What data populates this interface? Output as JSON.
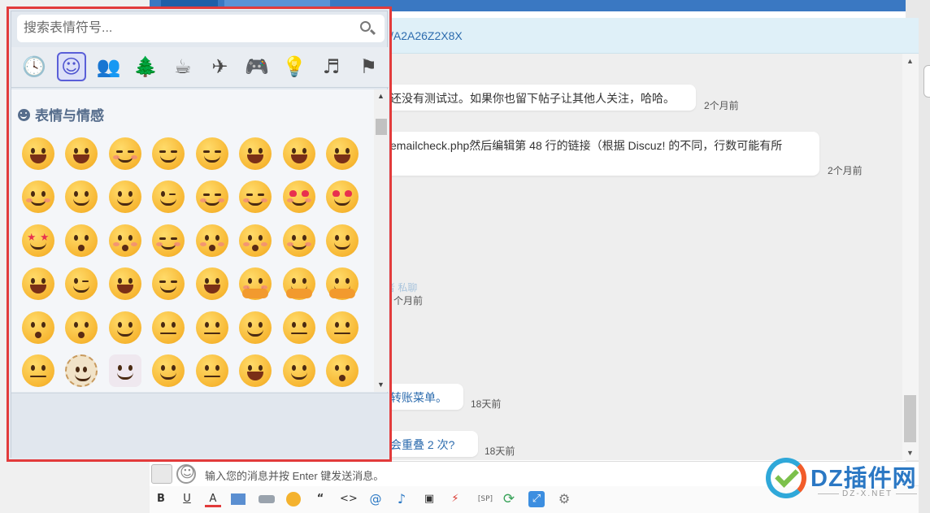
{
  "link_bar": {
    "text": "/A2A26Z2X8X"
  },
  "messages": [
    {
      "text": "还没有测试过。如果你也留下帖子让其他人关注，哈哈。",
      "time": "2个月前"
    },
    {
      "text": "emailcheck.php然后编辑第 48 行的链接（根据 Discuz! 的不同，行数可能有所",
      "time": "2个月前"
    },
    {
      "text": "者  私聊",
      "time": "个月前"
    },
    {
      "text": "转账菜单。",
      "time": "18天前"
    },
    {
      "text": "会重叠 2 次?",
      "time": "18天前"
    }
  ],
  "input": {
    "placeholder": "输入您的消息并按 Enter 键发送消息。"
  },
  "toolbar": {
    "bold": "B",
    "underline": "U",
    "font_color": "A",
    "quote": "“",
    "code": "<>",
    "at": "@",
    "music": "♪",
    "film": "▣",
    "flash": "⚡",
    "sp": "[SP]",
    "refresh": "⟳",
    "resize": "⤢",
    "settings": "⚙"
  },
  "emoji_picker": {
    "search_placeholder": "搜索表情符号...",
    "categories": [
      {
        "name": "recent",
        "glyph": "🕓",
        "active": false
      },
      {
        "name": "smileys",
        "glyph": "☺",
        "active": true
      },
      {
        "name": "people",
        "glyph": "👥",
        "active": false
      },
      {
        "name": "nature",
        "glyph": "🌲",
        "active": false
      },
      {
        "name": "food",
        "glyph": "☕",
        "active": false
      },
      {
        "name": "travel",
        "glyph": "✈",
        "active": false
      },
      {
        "name": "activities",
        "glyph": "🎮",
        "active": false
      },
      {
        "name": "objects",
        "glyph": "💡",
        "active": false
      },
      {
        "name": "symbols",
        "glyph": "♬",
        "active": false
      },
      {
        "name": "flags",
        "glyph": "⚑",
        "active": false
      }
    ],
    "section_title": "表情与情感",
    "emojis": [
      "grinning-face",
      "grinning-face-big-eyes",
      "grinning-face-smiling-eyes",
      "beaming-face",
      "grinning-squinting-face",
      "grinning-sweat",
      "rolling-on-floor-laughing",
      "face-with-tears-of-joy",
      "slightly-smiling",
      "upside-down",
      "melting-face",
      "winking-face",
      "smiling-eyes",
      "smiling-halo",
      "smiling-hearts",
      "heart-eyes",
      "star-struck",
      "face-blowing-kiss",
      "kissing-face",
      "smiling-face",
      "kissing-closed-eyes",
      "kissing-smiling-eyes",
      "smiling-tear",
      "face-savoring-food",
      "tongue-out",
      "winking-tongue",
      "zany-face",
      "squinting-tongue",
      "money-mouth",
      "hugging-face",
      "open-eyes-hand-over-mouth",
      "hand-over-mouth",
      "face-peeking",
      "shushing-face",
      "thinking-face",
      "saluting-face",
      "zipper-mouth",
      "raised-eyebrow",
      "neutral-face",
      "expressionless-face",
      "no-mouth",
      "dotted-line-face",
      "face-in-clouds",
      "smirking-face",
      "unamused-face",
      "rolling-eyes",
      "grimacing-face",
      "face-exhaling"
    ]
  },
  "watermark": {
    "brand": "DZ插件网",
    "domain": "DZ-X.NET"
  }
}
